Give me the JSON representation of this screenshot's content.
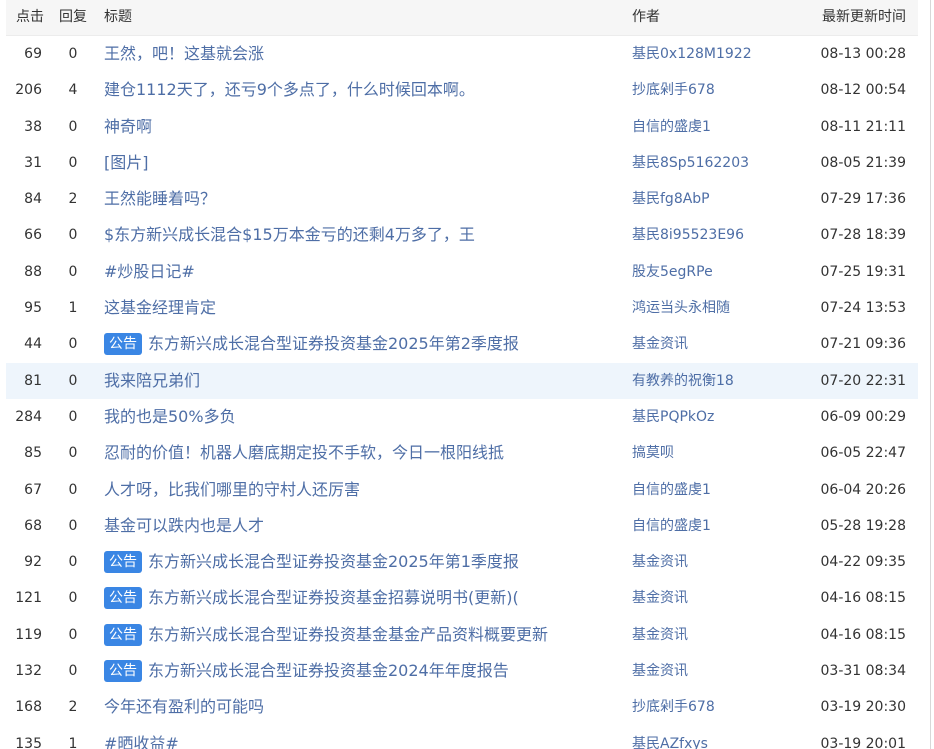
{
  "header": {
    "clicks": "点击",
    "replies": "回复",
    "title": "标题",
    "author": "作者",
    "updated": "最新更新时间"
  },
  "rows": [
    {
      "clicks": "69",
      "replies": "0",
      "badge": "",
      "title": "王然，吧！这基就会涨",
      "author": "基民0x128M1922",
      "time": "08-13 00:28"
    },
    {
      "clicks": "206",
      "replies": "4",
      "badge": "",
      "title": "建仓1112天了，还亏9个多点了，什么时候回本啊。",
      "author": "抄底剁手678",
      "time": "08-12 00:54"
    },
    {
      "clicks": "38",
      "replies": "0",
      "badge": "",
      "title": "神奇啊",
      "author": "自信的盛虔1",
      "time": "08-11 21:11"
    },
    {
      "clicks": "31",
      "replies": "0",
      "badge": "",
      "title": "[图片]",
      "author": "基民8Sp5162203",
      "time": "08-05 21:39"
    },
    {
      "clicks": "84",
      "replies": "2",
      "badge": "",
      "title": "王然能睡着吗？",
      "author": "基民fg8AbP",
      "time": "07-29 17:36"
    },
    {
      "clicks": "66",
      "replies": "0",
      "badge": "",
      "title": "$东方新兴成长混合$15万本金亏的还剩4万多了，王",
      "author": "基民8i95523E96",
      "time": "07-28 18:39"
    },
    {
      "clicks": "88",
      "replies": "0",
      "badge": "",
      "title": "#炒股日记#",
      "author": "股友5egRPe",
      "time": "07-25 19:31"
    },
    {
      "clicks": "95",
      "replies": "1",
      "badge": "",
      "title": "这基金经理肯定",
      "author": "鸿运当头永相随",
      "time": "07-24 13:53"
    },
    {
      "clicks": "44",
      "replies": "0",
      "badge": "公告",
      "title": "东方新兴成长混合型证券投资基金2025年第2季度报",
      "author": "基金资讯",
      "time": "07-21 09:36"
    },
    {
      "clicks": "81",
      "replies": "0",
      "badge": "",
      "title": "我来陪兄弟们",
      "author": "有教养的祝衡18",
      "time": "07-20 22:31"
    },
    {
      "clicks": "284",
      "replies": "0",
      "badge": "",
      "title": "我的也是50%多负",
      "author": "基民PQPkOz",
      "time": "06-09 00:29"
    },
    {
      "clicks": "85",
      "replies": "0",
      "badge": "",
      "title": "忍耐的价值！机器人磨底期定投不手软，今日一根阳线抵",
      "author": "搞莫呗",
      "time": "06-05 22:47"
    },
    {
      "clicks": "67",
      "replies": "0",
      "badge": "",
      "title": "人才呀，比我们哪里的守村人还厉害",
      "author": "自信的盛虔1",
      "time": "06-04 20:26"
    },
    {
      "clicks": "68",
      "replies": "0",
      "badge": "",
      "title": "基金可以跌内也是人才",
      "author": "自信的盛虔1",
      "time": "05-28 19:28"
    },
    {
      "clicks": "92",
      "replies": "0",
      "badge": "公告",
      "title": "东方新兴成长混合型证券投资基金2025年第1季度报",
      "author": "基金资讯",
      "time": "04-22 09:35"
    },
    {
      "clicks": "121",
      "replies": "0",
      "badge": "公告",
      "title": "东方新兴成长混合型证券投资基金招募说明书(更新)(",
      "author": "基金资讯",
      "time": "04-16 08:15"
    },
    {
      "clicks": "119",
      "replies": "0",
      "badge": "公告",
      "title": "东方新兴成长混合型证券投资基金基金产品资料概要更新",
      "author": "基金资讯",
      "time": "04-16 08:15"
    },
    {
      "clicks": "132",
      "replies": "0",
      "badge": "公告",
      "title": "东方新兴成长混合型证券投资基金2024年年度报告",
      "author": "基金资讯",
      "time": "03-31 08:34"
    },
    {
      "clicks": "168",
      "replies": "2",
      "badge": "",
      "title": "今年还有盈利的可能吗",
      "author": "抄底剁手678",
      "time": "03-19 20:30"
    },
    {
      "clicks": "135",
      "replies": "1",
      "badge": "",
      "title": "#晒收益#",
      "author": "基民AZfxys",
      "time": "03-19 20:01"
    }
  ],
  "highlighted_row": 10,
  "colors": {
    "link": "#4e6ea6",
    "text": "#333333",
    "badge_bg": "#3a86e4",
    "header_bg": "#f6f6f6",
    "highlight_bg": "#eef5fc"
  }
}
